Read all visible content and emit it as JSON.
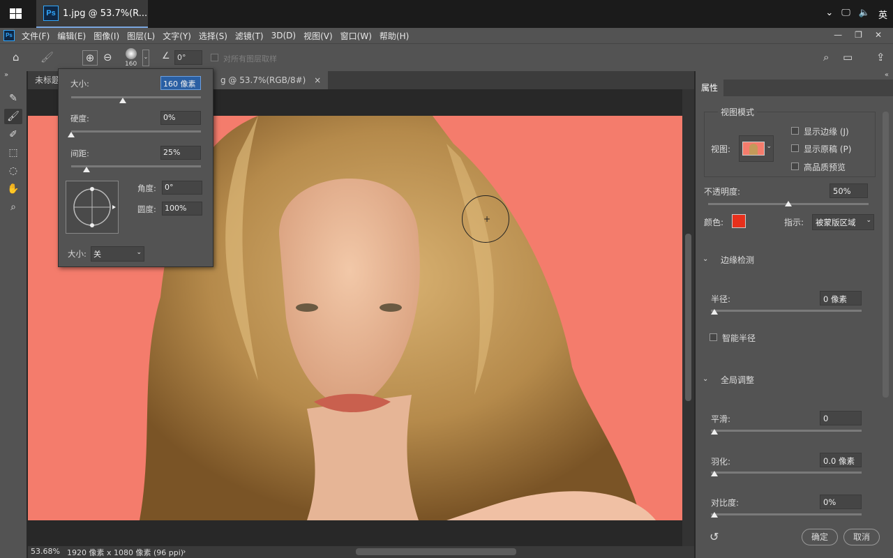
{
  "taskbar": {
    "app_title": "1.jpg @ 53.7%(R...",
    "ime": "英",
    "tray_icons": [
      "chevron-up-icon",
      "network-icon",
      "volume-icon"
    ]
  },
  "menubar": {
    "items": [
      "文件(F)",
      "编辑(E)",
      "图像(I)",
      "图层(L)",
      "文字(Y)",
      "选择(S)",
      "滤镜(T)",
      "3D(D)",
      "视图(V)",
      "窗口(W)",
      "帮助(H)"
    ]
  },
  "options": {
    "brush_size": "160",
    "angle": "0°",
    "sample_all_layers": "对所有图层取样"
  },
  "tabs": {
    "tab1": "未标题",
    "tab2": "g @ 53.7%(RGB/8#)",
    "close": "×"
  },
  "brush_popup": {
    "size_label": "大小:",
    "size_value": "160 像素",
    "hardness_label": "硬度:",
    "hardness_value": "0%",
    "spacing_label": "间距:",
    "spacing_value": "25%",
    "angle_label": "角度:",
    "angle_value": "0°",
    "roundness_label": "圆度:",
    "roundness_value": "100%",
    "pen_size_label": "大小:",
    "pen_size_value": "关",
    "size_fraction": 0.4,
    "hardness_fraction": 0.0,
    "spacing_fraction": 0.12
  },
  "status": {
    "zoom": "53.68%",
    "doc_info": "1920 像素 x 1080 像素 (96 ppi)"
  },
  "properties": {
    "tab": "属性",
    "view_mode_title": "视图模式",
    "view_label": "视图:",
    "show_edge": "显示边缘 (J)",
    "show_original": "显示原稿 (P)",
    "hq_preview": "高品质预览",
    "opacity_label": "不透明度:",
    "opacity_value": "50%",
    "opacity_fraction": 0.5,
    "color_label": "颜色:",
    "color": "#e8301c",
    "indicate_label": "指示:",
    "indicate_value": "被蒙版区域",
    "edge_section": "边缘检测",
    "radius_label": "半径:",
    "radius_value": "0 像素",
    "smart_radius": "智能半径",
    "global_section": "全局调整",
    "smooth_label": "平滑:",
    "smooth_value": "0",
    "feather_label": "羽化:",
    "feather_value": "0.0 像素",
    "contrast_label": "对比度:",
    "contrast_value": "0%",
    "ok": "确定",
    "cancel": "取消"
  }
}
